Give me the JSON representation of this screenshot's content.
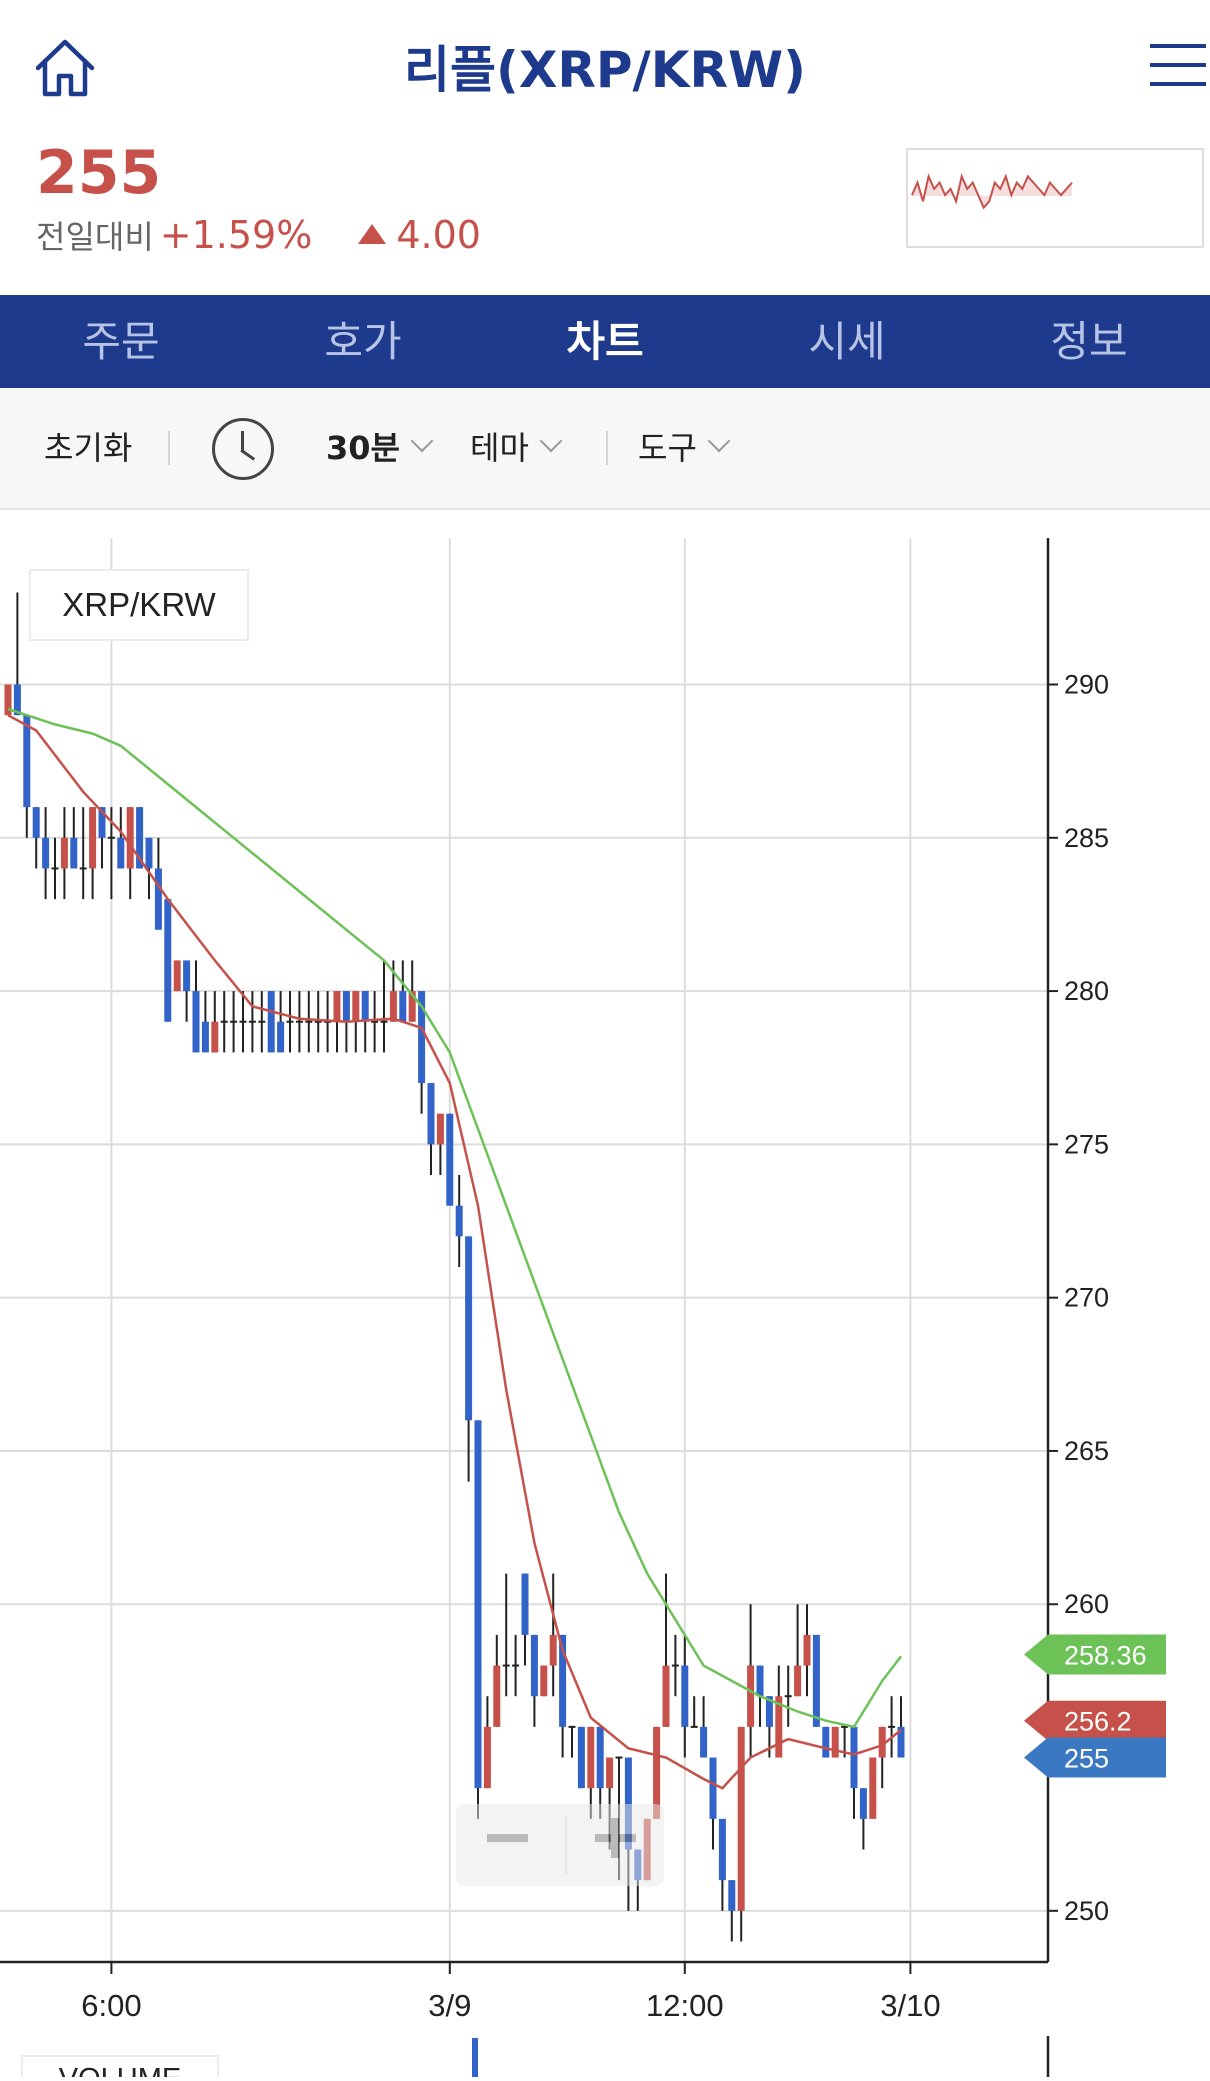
{
  "header": {
    "title": "리플(XRP/KRW)",
    "icons": {
      "home": "home-icon",
      "menu": "hamburger-menu-icon"
    }
  },
  "ticker": {
    "price": "255",
    "change_label": "전일대비",
    "change_pct": "+1.59%",
    "change_amount": "4.00",
    "up_color": "#c5514a"
  },
  "tabs": [
    {
      "label": "주문",
      "active": false
    },
    {
      "label": "호가",
      "active": false
    },
    {
      "label": "차트",
      "active": true
    },
    {
      "label": "시세",
      "active": false
    },
    {
      "label": "정보",
      "active": false
    }
  ],
  "toolbar": {
    "reset": "초기화",
    "interval": "30분",
    "theme": "테마",
    "tools": "도구"
  },
  "chart_data": {
    "type": "candlestick",
    "symbol_label": "XRP/KRW",
    "y_ticks": [
      290,
      285,
      280,
      275,
      270,
      265,
      260,
      250
    ],
    "ylim": [
      248.2,
      293.8
    ],
    "x_ticks": [
      {
        "label": "6:00",
        "index": 11
      },
      {
        "label": "3/9",
        "index": 47
      },
      {
        "label": "12:00",
        "index": 72
      },
      {
        "label": "3/10",
        "index": 96
      }
    ],
    "candles": [
      [
        289,
        290,
        290,
        289
      ],
      [
        290,
        289,
        293,
        289
      ],
      [
        289,
        286,
        289,
        285
      ],
      [
        286,
        285,
        286,
        284
      ],
      [
        285,
        284,
        286,
        283
      ],
      [
        284,
        284,
        285,
        283
      ],
      [
        284,
        285,
        286,
        283
      ],
      [
        285,
        284,
        286,
        284
      ],
      [
        284,
        284,
        286,
        283
      ],
      [
        284,
        286,
        286,
        283
      ],
      [
        286,
        285,
        286,
        284
      ],
      [
        285,
        285,
        286,
        283
      ],
      [
        285,
        284,
        286,
        284
      ],
      [
        284,
        286,
        286,
        283
      ],
      [
        286,
        284,
        286,
        284
      ],
      [
        285,
        284,
        285,
        283
      ],
      [
        284,
        282,
        285,
        283
      ],
      [
        283,
        279,
        283,
        279
      ],
      [
        280,
        281,
        281,
        280
      ],
      [
        281,
        280,
        281,
        279
      ],
      [
        280,
        278,
        281,
        278
      ],
      [
        279,
        278,
        280,
        278
      ],
      [
        278,
        279,
        280,
        278
      ],
      [
        279,
        279,
        280,
        278
      ],
      [
        279,
        279,
        280,
        278
      ],
      [
        279,
        279,
        280,
        278
      ],
      [
        279,
        279,
        280,
        278
      ],
      [
        279,
        279,
        280,
        278
      ],
      [
        280,
        278,
        280,
        278
      ],
      [
        279,
        278,
        280,
        278
      ],
      [
        279,
        279,
        280,
        278
      ],
      [
        279,
        279,
        280,
        278
      ],
      [
        279,
        279,
        280,
        278
      ],
      [
        279,
        279,
        280,
        278
      ],
      [
        279,
        279,
        280,
        278
      ],
      [
        279,
        280,
        280,
        278
      ],
      [
        280,
        279,
        280,
        278
      ],
      [
        279,
        280,
        280,
        278
      ],
      [
        280,
        279,
        280,
        278
      ],
      [
        279,
        279,
        280,
        278
      ],
      [
        279,
        279,
        281,
        278
      ],
      [
        279,
        280,
        281,
        279
      ],
      [
        280,
        279,
        281,
        279
      ],
      [
        279,
        280,
        281,
        279
      ],
      [
        280,
        277,
        280,
        276
      ],
      [
        277,
        275,
        277,
        274
      ],
      [
        275,
        276,
        276,
        274
      ],
      [
        276,
        273,
        276,
        273
      ],
      [
        273,
        272,
        274,
        271
      ],
      [
        272,
        266,
        272,
        264
      ],
      [
        266,
        254,
        266,
        253
      ],
      [
        254,
        256,
        257,
        254
      ],
      [
        256,
        258,
        259,
        256
      ],
      [
        258,
        258,
        261,
        257
      ],
      [
        258,
        258,
        259,
        257
      ],
      [
        261,
        259,
        261,
        258
      ],
      [
        259,
        257,
        259,
        256
      ],
      [
        257,
        258,
        258,
        257
      ],
      [
        258,
        259,
        261,
        257
      ],
      [
        259,
        256,
        259,
        255
      ],
      [
        256,
        256,
        256,
        255
      ],
      [
        256,
        254,
        256,
        254
      ],
      [
        254,
        256,
        256,
        253
      ],
      [
        256,
        254,
        256,
        253
      ],
      [
        254,
        255,
        255,
        252
      ],
      [
        255,
        255,
        255,
        251
      ],
      [
        255,
        252,
        255,
        250
      ],
      [
        252,
        251,
        252,
        250
      ],
      [
        251,
        253,
        253,
        251
      ],
      [
        253,
        256,
        256,
        253
      ],
      [
        256,
        258,
        261,
        256
      ],
      [
        258,
        258,
        259,
        257
      ],
      [
        258,
        256,
        259,
        255
      ],
      [
        256,
        256,
        257,
        256
      ],
      [
        256,
        255,
        257,
        255
      ],
      [
        255,
        253,
        255,
        252
      ],
      [
        253,
        251,
        253,
        250
      ],
      [
        251,
        250,
        251,
        249
      ],
      [
        250,
        256,
        256,
        249
      ],
      [
        256,
        258,
        260,
        255
      ],
      [
        258,
        257,
        258,
        256
      ],
      [
        257,
        256,
        257,
        255
      ],
      [
        255,
        257,
        258,
        255
      ],
      [
        257,
        257,
        258,
        256
      ],
      [
        257,
        258,
        260,
        257
      ],
      [
        258,
        259,
        260,
        257
      ],
      [
        259,
        256,
        259,
        256
      ],
      [
        256,
        255,
        256,
        255
      ],
      [
        255,
        256,
        256,
        255
      ],
      [
        256,
        256,
        256,
        255
      ],
      [
        256,
        254,
        256,
        253
      ],
      [
        254,
        253,
        254,
        252
      ],
      [
        253,
        255,
        255,
        253
      ],
      [
        255,
        256,
        256,
        254
      ],
      [
        256,
        256,
        257,
        255
      ],
      [
        256,
        255,
        257,
        255
      ]
    ],
    "ma_short": [
      [
        0,
        289
      ],
      [
        3,
        288.5
      ],
      [
        8,
        286.5
      ],
      [
        12,
        285.2
      ],
      [
        17,
        283
      ],
      [
        22,
        281
      ],
      [
        26,
        279.5
      ],
      [
        31,
        279.1
      ],
      [
        36,
        279
      ],
      [
        41,
        279.1
      ],
      [
        44,
        278.8
      ],
      [
        47,
        277
      ],
      [
        50,
        273
      ],
      [
        53,
        267
      ],
      [
        56,
        262
      ],
      [
        59,
        258.5
      ],
      [
        62,
        256.3
      ],
      [
        66,
        255.3
      ],
      [
        70,
        255
      ],
      [
        74,
        254.3
      ],
      [
        76,
        254
      ],
      [
        79,
        255
      ],
      [
        83,
        255.6
      ],
      [
        87,
        255.3
      ],
      [
        90,
        255.1
      ],
      [
        93,
        255.4
      ],
      [
        95,
        255.9
      ]
    ],
    "ma_long": [
      [
        0,
        289.2
      ],
      [
        5,
        288.7
      ],
      [
        9,
        288.4
      ],
      [
        12,
        288
      ],
      [
        16,
        287
      ],
      [
        20,
        286
      ],
      [
        24,
        285
      ],
      [
        28,
        284
      ],
      [
        32,
        283
      ],
      [
        36,
        282
      ],
      [
        40,
        281
      ],
      [
        44,
        279.5
      ],
      [
        47,
        278
      ],
      [
        50,
        275.5
      ],
      [
        53,
        273
      ],
      [
        56,
        270.5
      ],
      [
        59,
        268
      ],
      [
        62,
        265.5
      ],
      [
        65,
        263
      ],
      [
        68,
        261
      ],
      [
        71,
        259.5
      ],
      [
        74,
        258
      ],
      [
        77,
        257.5
      ],
      [
        80,
        257
      ],
      [
        84,
        256.5
      ],
      [
        87,
        256.2
      ],
      [
        90,
        256
      ],
      [
        93,
        257.5
      ],
      [
        95,
        258.3
      ]
    ],
    "tags": [
      {
        "label": "258.36",
        "value": 258.36,
        "color": "#6dc257"
      },
      {
        "label": "256.2",
        "value": 256.2,
        "color": "#c5514a"
      },
      {
        "label": "255",
        "value": 255,
        "color": "#3b78c2"
      }
    ],
    "up_color": "#c5514a",
    "down_color": "#3263c8",
    "ma_short_color": "#c5514a",
    "ma_long_color": "#6dc257",
    "volume_label": "VOLUME",
    "mini_chart": [
      256,
      258,
      255,
      259,
      257,
      258,
      256,
      257,
      255,
      259,
      257,
      258,
      256,
      254,
      255,
      258,
      257,
      259,
      256,
      258,
      257,
      259,
      258,
      257,
      256,
      258,
      257,
      256,
      257,
      258
    ]
  }
}
